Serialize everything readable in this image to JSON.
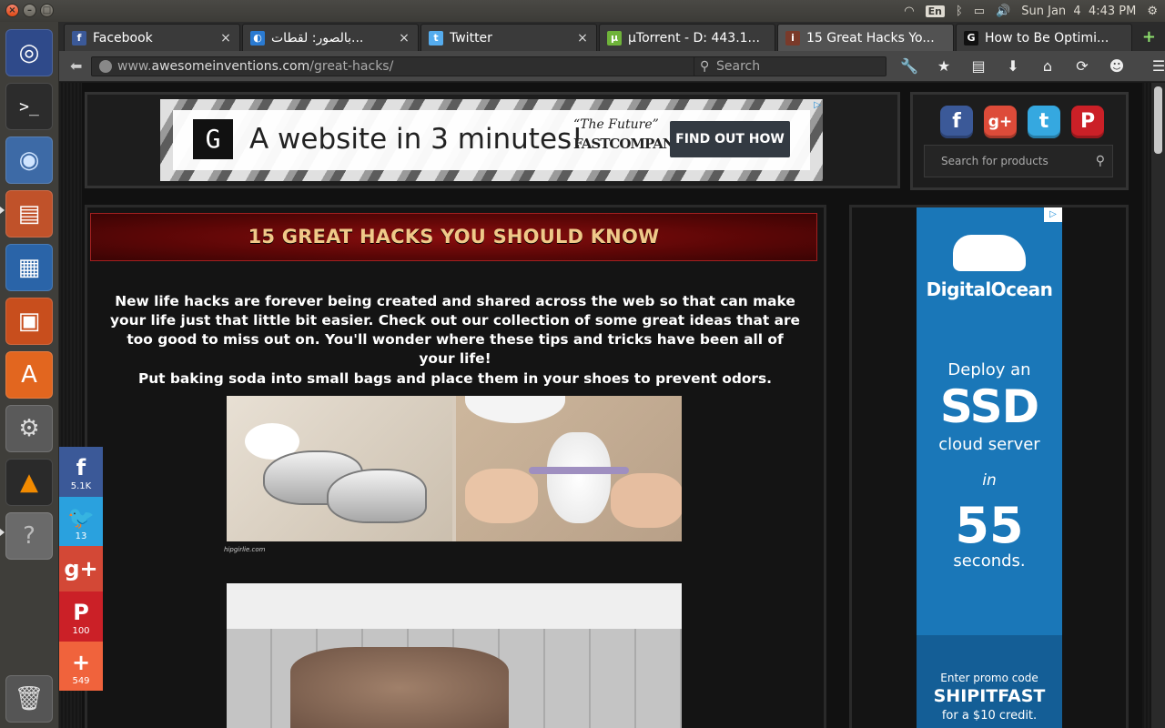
{
  "system": {
    "clock": "Sun Jan  4  4:43 PM",
    "keyboard_lang": "En"
  },
  "launcher": {
    "items": [
      "ubuntu-dash",
      "terminal",
      "chromium",
      "files",
      "writer",
      "impress",
      "software-center",
      "system-settings",
      "vlc",
      "help",
      "trash"
    ]
  },
  "tabs": [
    {
      "title": "Facebook",
      "favicon": "f",
      "color": "#3b5998"
    },
    {
      "title": "بالصور: لقطات...",
      "favicon": "◐",
      "color": "#2a7ad1"
    },
    {
      "title": "Twitter",
      "favicon": "t",
      "color": "#55acee"
    },
    {
      "title": "µTorrent - D: 443.1...",
      "favicon": "µ",
      "color": "#6fb33a"
    },
    {
      "title": "15 Great Hacks Yo...",
      "favicon": "i",
      "color": "#7a3a2a"
    },
    {
      "title": "How to Be Optimi...",
      "favicon": "G",
      "color": "#111111"
    }
  ],
  "navbar": {
    "url_prefix": "www.",
    "url_host": "awesomeinventions.com",
    "url_path": "/great-hacks/",
    "search_placeholder": "Search"
  },
  "ad_top": {
    "headline": "A website in 3 minutes!",
    "quote": "“The Future”",
    "publisher": "FASTCOMPANY",
    "cta": "FIND OUT HOW"
  },
  "sidebar_search": {
    "placeholder": "Search for products"
  },
  "article": {
    "title": "15 GREAT HACKS YOU SHOULD KNOW",
    "intro": "New life hacks are forever being created and shared across the web so that can make your life just that little bit easier. Check out our collection of some great ideas that are too good to miss out on. You'll wonder where these tips and tricks have been all of your life!",
    "tip1": "Put baking soda into small bags and place them in your shoes to prevent odors.",
    "img1_credit": "hipgirlie.com"
  },
  "do_ad": {
    "brand": "DigitalOcean",
    "deploy": "Deploy an",
    "ssd": "SSD",
    "cloud": "cloud server",
    "in": "in",
    "num": "55",
    "seconds": "seconds.",
    "enter": "Enter promo code",
    "code": "SHIPITFAST",
    "credit": "for a $10 credit."
  },
  "share": [
    {
      "network": "facebook",
      "icon": "f",
      "count": "5.1K",
      "color": "#3b5998"
    },
    {
      "network": "twitter",
      "icon": "🐦",
      "count": "13",
      "color": "#2aa1de"
    },
    {
      "network": "google-plus",
      "icon": "g+",
      "count": "",
      "color": "#d34836"
    },
    {
      "network": "pinterest",
      "icon": "P",
      "count": "100",
      "color": "#cb2027"
    },
    {
      "network": "more",
      "icon": "+",
      "count": "549",
      "color": "#f0633c"
    }
  ]
}
